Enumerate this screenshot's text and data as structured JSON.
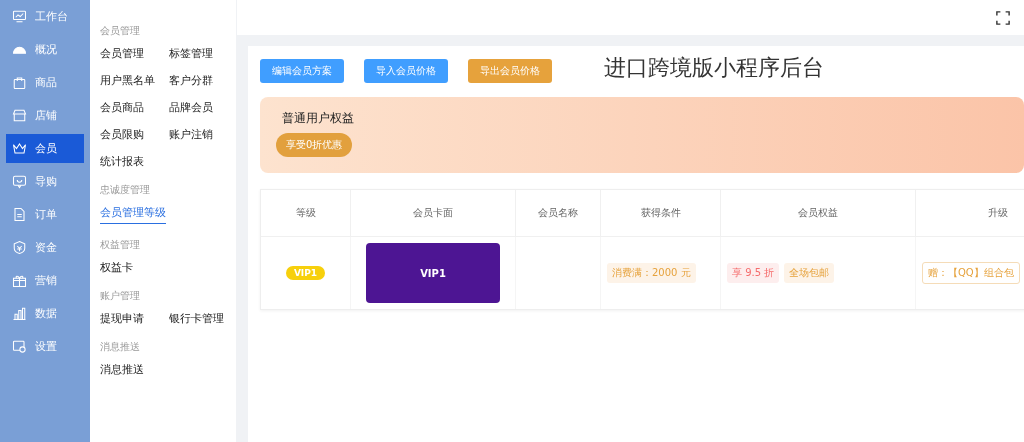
{
  "sidebar": {
    "items": [
      {
        "label": "工作台",
        "selected": false
      },
      {
        "label": "概况",
        "selected": false
      },
      {
        "label": "商品",
        "selected": false
      },
      {
        "label": "店铺",
        "selected": false
      },
      {
        "label": "会员",
        "selected": true
      },
      {
        "label": "导购",
        "selected": false
      },
      {
        "label": "订单",
        "selected": false
      },
      {
        "label": "资金",
        "selected": false
      },
      {
        "label": "营销",
        "selected": false
      },
      {
        "label": "数据",
        "selected": false
      },
      {
        "label": "设置",
        "selected": false
      }
    ]
  },
  "submenu": {
    "groups": [
      {
        "title": "会员管理",
        "items": [
          {
            "label": "会员管理",
            "selected": false
          },
          {
            "label": "标签管理",
            "selected": false
          },
          {
            "label": "用户黑名单",
            "selected": false
          },
          {
            "label": "客户分群",
            "selected": false
          },
          {
            "label": "会员商品",
            "selected": false
          },
          {
            "label": "品牌会员",
            "selected": false
          },
          {
            "label": "会员限购",
            "selected": false
          },
          {
            "label": "账户注销",
            "selected": false
          },
          {
            "label": "统计报表",
            "selected": false
          }
        ]
      },
      {
        "title": "忠诚度管理",
        "items": [
          {
            "label": "会员管理等级",
            "selected": true
          }
        ]
      },
      {
        "title": "权益管理",
        "items": [
          {
            "label": "权益卡",
            "selected": false
          }
        ]
      },
      {
        "title": "账户管理",
        "items": [
          {
            "label": "提现申请",
            "selected": false
          },
          {
            "label": "银行卡管理",
            "selected": false
          }
        ]
      },
      {
        "title": "消息推送",
        "items": [
          {
            "label": "消息推送",
            "selected": false
          }
        ]
      }
    ]
  },
  "toolbar": {
    "buttons": [
      {
        "label": "编辑会员方案",
        "color": "#409eff"
      },
      {
        "label": "导入会员价格",
        "color": "#409eff"
      },
      {
        "label": "导出会员价格",
        "color": "#e6a23c"
      }
    ]
  },
  "page_title": "进口跨境版小程序后台",
  "banner": {
    "title": "普通用户权益",
    "badge": "享受0折优惠"
  },
  "table": {
    "columns": [
      "等级",
      "会员卡面",
      "会员名称",
      "获得条件",
      "会员权益",
      "升级"
    ],
    "rows": [
      {
        "level": "VIP1",
        "card": {
          "label": "VIP1",
          "color": "#4d1593"
        },
        "conditions": [
          {
            "text": "消费满：2000 元"
          }
        ],
        "benefits": [
          {
            "text": "享 9.5 折",
            "kind": "discount"
          },
          {
            "text": "全场包邮",
            "kind": "perk"
          }
        ],
        "upgrade": [
          {
            "text": "赠：【QQ】组合包"
          }
        ]
      }
    ]
  }
}
